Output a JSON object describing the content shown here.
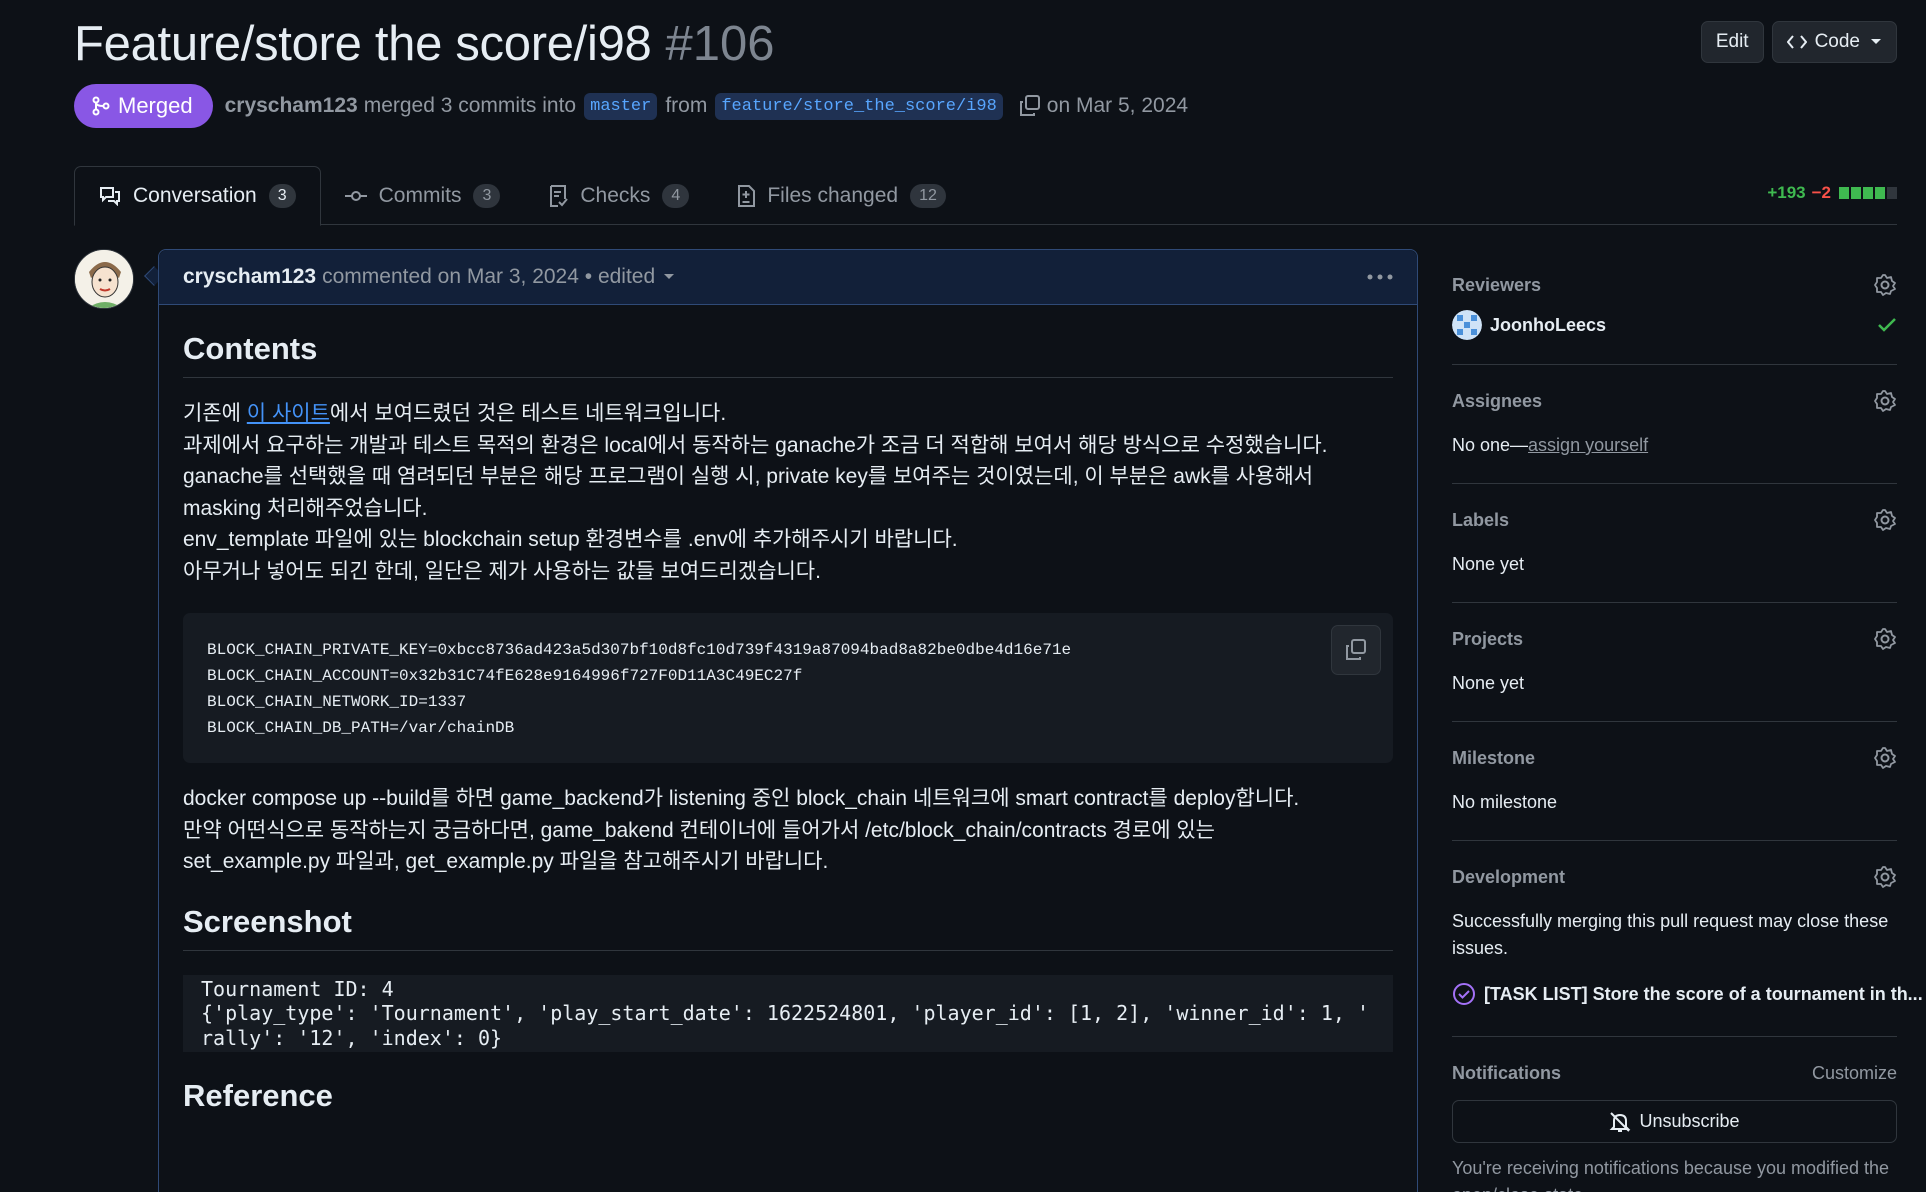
{
  "pr": {
    "title": "Feature/store the score/i98",
    "number": "#106",
    "edit_label": "Edit",
    "code_label": "Code",
    "status": "Merged",
    "author": "cryscham123",
    "merge_text": "merged 3 commits into",
    "base_branch": "master",
    "from_text": "from",
    "head_branch": "feature/store_the_score/i98",
    "date_text": "on Mar 5, 2024"
  },
  "tabs": [
    {
      "label": "Conversation",
      "count": "3"
    },
    {
      "label": "Commits",
      "count": "3"
    },
    {
      "label": "Checks",
      "count": "4"
    },
    {
      "label": "Files changed",
      "count": "12"
    }
  ],
  "diffstat": {
    "additions": "+193",
    "deletions": "−2"
  },
  "comment": {
    "author": "cryscham123",
    "meta": "commented on Mar 3, 2024 • edited",
    "heading_contents": "Contents",
    "p1_before": "기존에 ",
    "p1_link": "이 사이트",
    "p1_after": "에서 보여드렸던 것은 테스트 네트워크입니다.",
    "p1_line2": "과제에서 요구하는 개발과 테스트 목적의 환경은 local에서 동작하는 ganache가 조금 더 적합해 보여서 해당 방식으로 수정했습니다.",
    "p1_line3": "ganache를 선택했을 때 염려되던 부분은 해당 프로그램이 실행 시, private key를 보여주는 것이였는데, 이 부분은 awk를 사용해서 masking 처리해주었습니다.",
    "p1_line4": "env_template 파일에 있는 blockchain setup 환경변수를 .env에 추가해주시기 바랍니다.",
    "p1_line5": "아무거나 넣어도 되긴 한데, 일단은 제가 사용하는 값들 보여드리겠습니다.",
    "code_lines": [
      "BLOCK_CHAIN_PRIVATE_KEY=0xbcc8736ad423a5d307bf10d8fc10d739f4319a87094bad8a82be0dbe4d16e71e",
      "BLOCK_CHAIN_ACCOUNT=0x32b31C74fE628e9164996f727F0D11A3C49EC27f",
      "BLOCK_CHAIN_NETWORK_ID=1337",
      "BLOCK_CHAIN_DB_PATH=/var/chainDB"
    ],
    "p2_line1": "docker compose up --build를 하면 game_backend가 listening 중인 block_chain 네트워크에 smart contract를 deploy합니다.",
    "p2_line2": "만약 어떤식으로 동작하는지 궁금하다면, game_bakend 컨테이너에 들어가서 /etc/block_chain/contracts 경로에 있는",
    "p2_line3": "set_example.py 파일과, get_example.py 파일을 참고해주시기 바랍니다.",
    "heading_screenshot": "Screenshot",
    "shot_lines": [
      "Tournament ID: 4",
      "{'play_type': 'Tournament', 'play_start_date': 1622524801, 'player_id': [1, 2], 'winner_id': 1, '",
      "rally': '12', 'index': 0}"
    ],
    "heading_reference": "Reference"
  },
  "sidebar": {
    "reviewers_title": "Reviewers",
    "reviewer_name": "JoonhoLeecs",
    "assignees_title": "Assignees",
    "assignees_none": "No one—",
    "assign_yourself": "assign yourself",
    "labels_title": "Labels",
    "labels_value": "None yet",
    "projects_title": "Projects",
    "projects_value": "None yet",
    "milestone_title": "Milestone",
    "milestone_value": "No milestone",
    "development_title": "Development",
    "development_text": "Successfully merging this pull request may close these issues.",
    "issue_title": "[TASK LIST] Store the score of a tournament in th...",
    "notifications_title": "Notifications",
    "customize": "Customize",
    "unsubscribe": "Unsubscribe",
    "notif_note": "You're receiving notifications because you modified the open/close state."
  },
  "colors": {
    "merged": "#8957e5",
    "link": "#4493f8",
    "add": "#3fb950",
    "del": "#f85149"
  }
}
